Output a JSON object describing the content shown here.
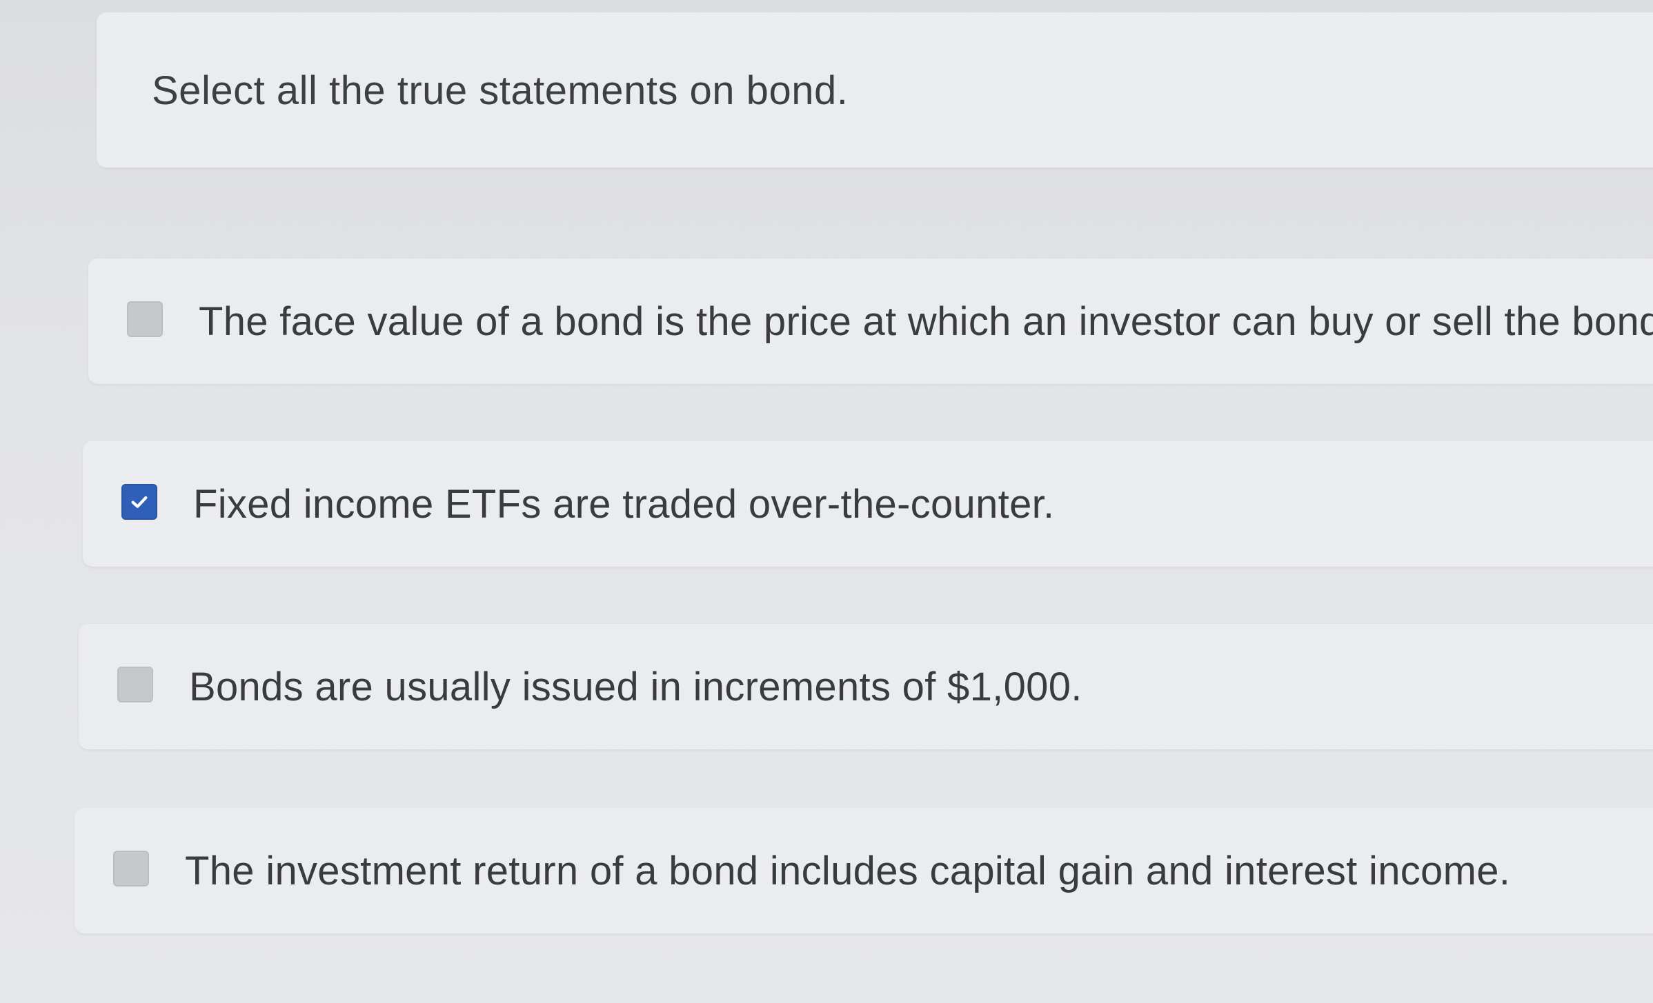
{
  "question": {
    "prompt": "Select all the true statements on bond."
  },
  "options": [
    {
      "label": "The face value of a bond is the price at which an investor can buy or sell the bond.",
      "checked": false
    },
    {
      "label": "Fixed income ETFs are traded over-the-counter.",
      "checked": true
    },
    {
      "label": "Bonds are usually issued in increments of $1,000.",
      "checked": false
    },
    {
      "label": "The investment return of a bond includes capital gain and interest income.",
      "checked": false
    }
  ],
  "colors": {
    "checkbox_checked": "#2f5fb6",
    "checkbox_unchecked": "#c7c8ca",
    "card_background": "#ebecee",
    "page_background": "#e3e4e6"
  },
  "icons": {
    "checked_mark": "checkmark-icon"
  }
}
